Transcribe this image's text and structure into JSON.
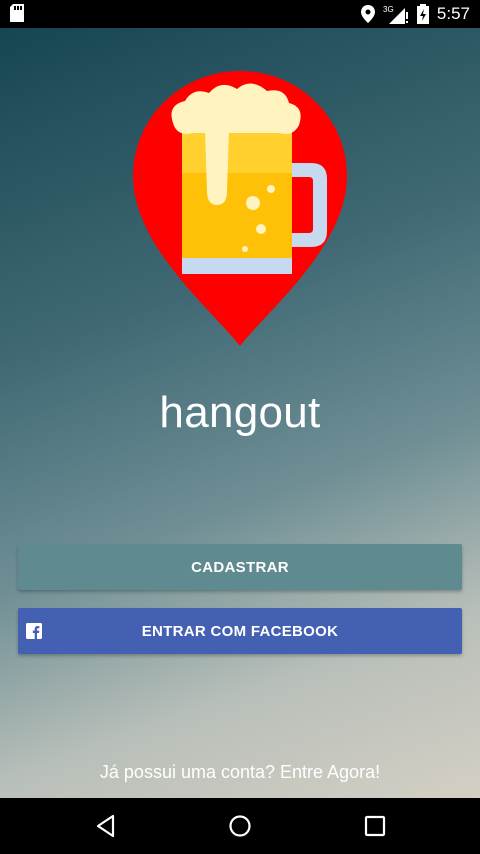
{
  "status_bar": {
    "time": "5:57",
    "network": "3G",
    "icons": [
      "sd-card-icon",
      "location-icon",
      "signal-icon",
      "battery-icon"
    ]
  },
  "app": {
    "title": "hangout",
    "logo_icon": "beer-mug-location-pin-icon",
    "colors": {
      "pin_red": "#ff0000",
      "button_primary": "#5e8a90",
      "button_facebook": "#4360b3"
    }
  },
  "actions": {
    "cadastrar_label": "CADASTRAR",
    "facebook_label": "ENTRAR COM FACEBOOK",
    "facebook_icon": "facebook-icon"
  },
  "footer": {
    "login_prompt": "Já possui uma conta? Entre Agora!"
  },
  "nav_bar": {
    "buttons": [
      "back-icon",
      "home-icon",
      "recents-icon"
    ]
  }
}
